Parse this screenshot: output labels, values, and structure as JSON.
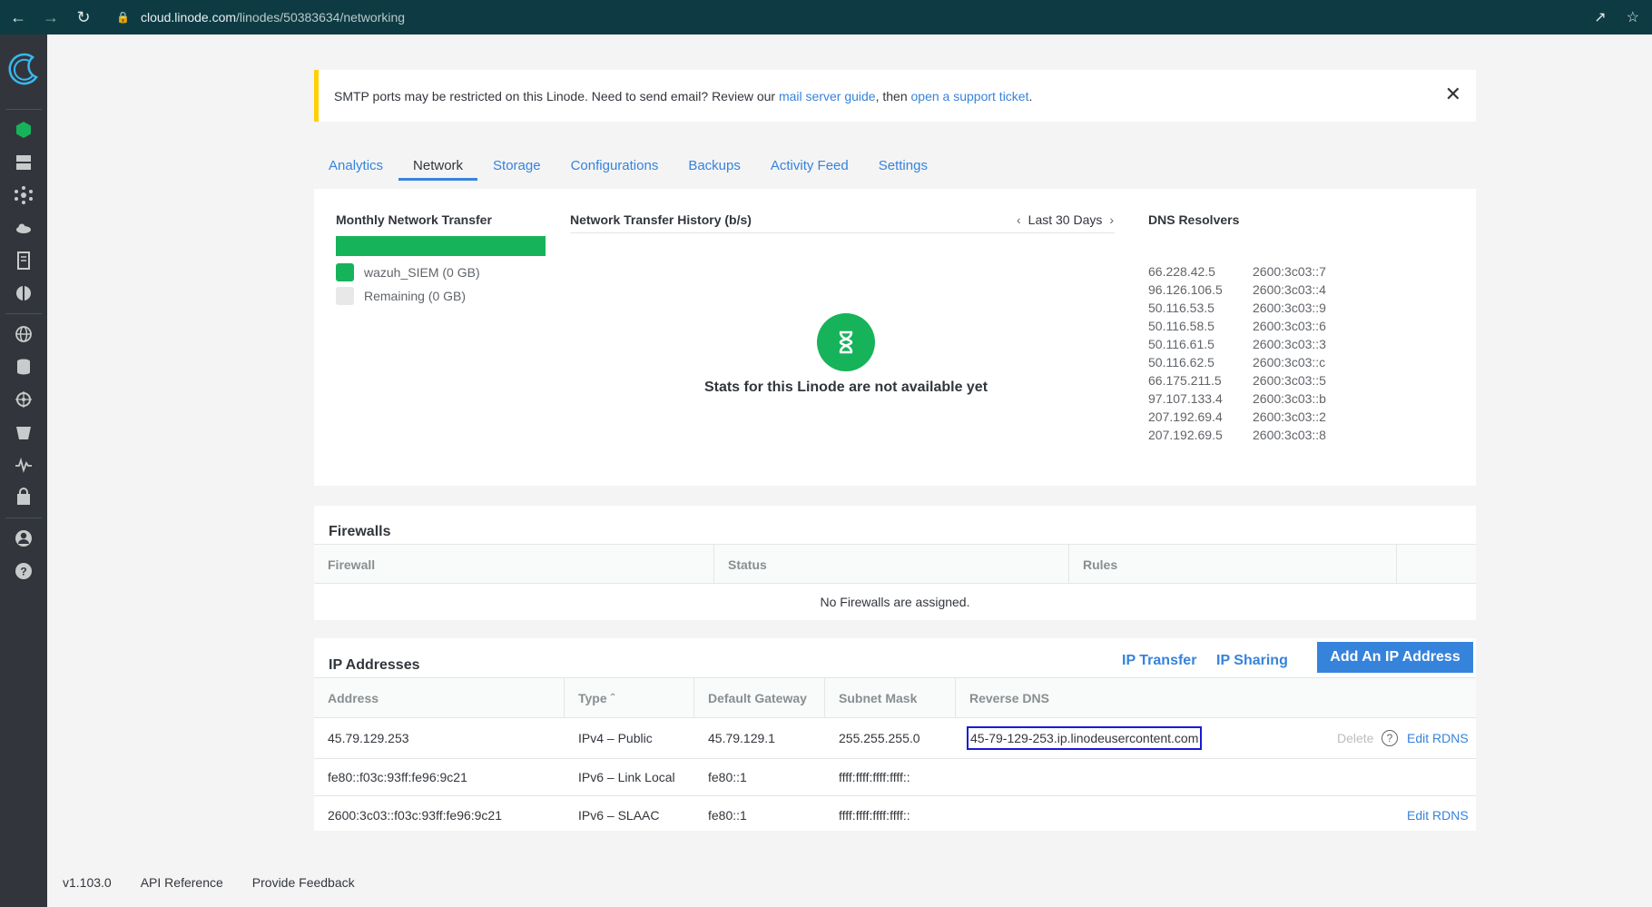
{
  "browser": {
    "url_host": "cloud.linode.com",
    "url_path": "/linodes/50383634/networking"
  },
  "notice": {
    "text_before": "SMTP ports may be restricted on this Linode. Need to send email? Review our ",
    "link1": "mail server guide",
    "text_mid": ", then ",
    "link2": "open a support ticket",
    "text_after": "."
  },
  "tabs": [
    "Analytics",
    "Network",
    "Storage",
    "Configurations",
    "Backups",
    "Activity Feed",
    "Settings"
  ],
  "transfer": {
    "title": "Monthly Network Transfer",
    "used_label": "wazuh_SIEM (0 GB)",
    "remaining_label": "Remaining (0 GB)",
    "used_color": "#17b35a",
    "remaining_color": "#e8e8e8"
  },
  "history": {
    "title": "Network Transfer History (b/s)",
    "range": "Last 30 Days",
    "empty_text": "Stats for this Linode are not available yet"
  },
  "dns": {
    "title": "DNS Resolvers",
    "rows": [
      [
        "66.228.42.5",
        "2600:3c03::7"
      ],
      [
        "96.126.106.5",
        "2600:3c03::4"
      ],
      [
        "50.116.53.5",
        "2600:3c03::9"
      ],
      [
        "50.116.58.5",
        "2600:3c03::6"
      ],
      [
        "50.116.61.5",
        "2600:3c03::3"
      ],
      [
        "50.116.62.5",
        "2600:3c03::c"
      ],
      [
        "66.175.211.5",
        "2600:3c03::5"
      ],
      [
        "97.107.133.4",
        "2600:3c03::b"
      ],
      [
        "207.192.69.4",
        "2600:3c03::2"
      ],
      [
        "207.192.69.5",
        "2600:3c03::8"
      ]
    ]
  },
  "firewalls": {
    "title": "Firewalls",
    "headers": [
      "Firewall",
      "Status",
      "Rules"
    ],
    "empty": "No Firewalls are assigned."
  },
  "ips": {
    "title": "IP Addresses",
    "transfer_link": "IP Transfer",
    "sharing_link": "IP Sharing",
    "add_button": "Add An IP Address",
    "headers": [
      "Address",
      "Type",
      "Default Gateway",
      "Subnet Mask",
      "Reverse DNS"
    ],
    "rows": [
      {
        "address": "45.79.129.253",
        "type": "IPv4 – Public",
        "gateway": "45.79.129.1",
        "mask": "255.255.255.0",
        "rdns": "45-79-129-253.ip.linodeusercontent.com",
        "delete": "Delete",
        "edit": "Edit RDNS"
      },
      {
        "address": "fe80::f03c:93ff:fe96:9c21",
        "type": "IPv6 – Link Local",
        "gateway": "fe80::1",
        "mask": "ffff:ffff:ffff:ffff::",
        "rdns": "",
        "delete": "",
        "edit": ""
      },
      {
        "address": "2600:3c03::f03c:93ff:fe96:9c21",
        "type": "IPv6 – SLAAC",
        "gateway": "fe80::1",
        "mask": "ffff:ffff:ffff:ffff::",
        "rdns": "",
        "delete": "",
        "edit": "Edit RDNS"
      }
    ]
  },
  "footer": {
    "version": "v1.103.0",
    "api": "API Reference",
    "feedback": "Provide Feedback"
  }
}
